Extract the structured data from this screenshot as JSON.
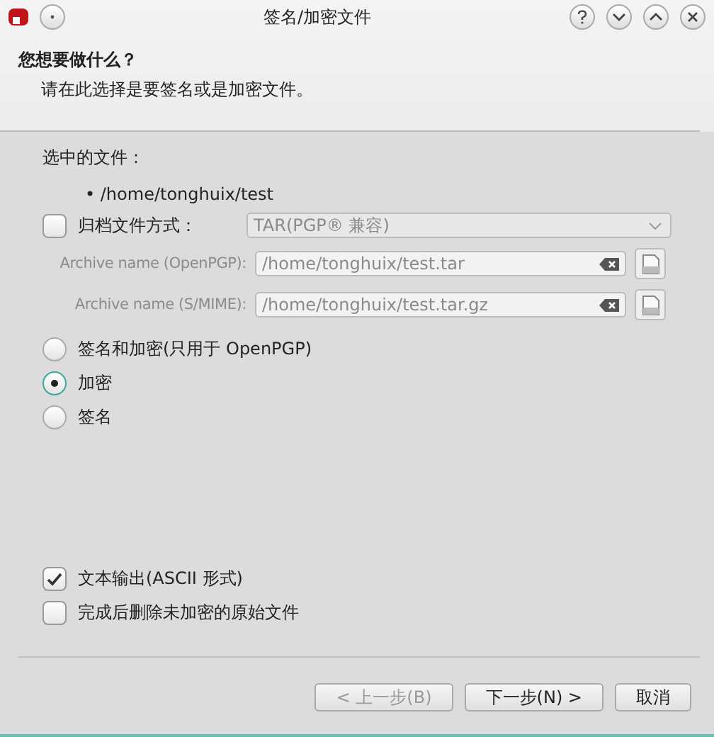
{
  "window": {
    "title": "签名/加密文件"
  },
  "header": {
    "heading": "您想要做什么？",
    "subtitle": "请在此选择是要签名或是加密文件。"
  },
  "selected_files": {
    "label": "选中的文件：",
    "files": [
      "• /home/tonghuix/test"
    ]
  },
  "archive": {
    "label": "归档文件方式：",
    "checked": false,
    "format": "TAR(PGP® 兼容)",
    "disabled": true
  },
  "archive_names": [
    {
      "label": "Archive name (OpenPGP):",
      "value": "/home/tonghuix/test.tar",
      "disabled": true
    },
    {
      "label": "Archive name (S/MIME):",
      "value": "/home/tonghuix/test.tar.gz",
      "disabled": true
    }
  ],
  "operations": [
    {
      "label": "签名和加密(只用于 OpenPGP)",
      "selected": false
    },
    {
      "label": "加密",
      "selected": true
    },
    {
      "label": "签名",
      "selected": false
    }
  ],
  "options": [
    {
      "label": "文本输出(ASCII 形式)",
      "checked": true
    },
    {
      "label": "完成后删除未加密的原始文件",
      "checked": false
    }
  ],
  "buttons": [
    {
      "label": "< 上一步(B)",
      "disabled": true
    },
    {
      "label": "下一步(N) >",
      "disabled": false
    },
    {
      "label": "取消",
      "disabled": false
    }
  ]
}
